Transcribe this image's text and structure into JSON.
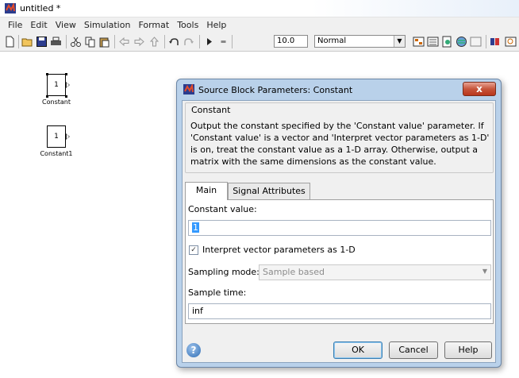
{
  "window": {
    "title": "untitled *"
  },
  "menu": [
    "File",
    "Edit",
    "View",
    "Simulation",
    "Format",
    "Tools",
    "Help"
  ],
  "toolbar": {
    "stop_time": "10.0",
    "sim_mode": "Normal",
    "icons": [
      "new-icon",
      "open-icon",
      "save-icon",
      "print-icon",
      "cut-icon",
      "copy-icon",
      "paste-icon",
      "back-icon",
      "forward-icon",
      "up-icon",
      "undo-icon",
      "redo-icon",
      "play-icon",
      "stop-icon",
      "build-icon",
      "model-explorer-icon",
      "debug-icon",
      "library-icon",
      "viewer-icon",
      "model-advisor-icon",
      "zoom-icon"
    ]
  },
  "canvas": {
    "blocks": [
      {
        "value": "1",
        "label": "Constant"
      },
      {
        "value": "1",
        "label": "Constant1"
      }
    ]
  },
  "dialog": {
    "title": "Source Block Parameters: Constant",
    "close_label": "x",
    "group_title": "Constant",
    "description": "Output the constant specified by the 'Constant value' parameter. If 'Constant value' is a vector and 'Interpret vector parameters as 1-D' is on, treat the constant value as a 1-D array. Otherwise, output a matrix with the same dimensions as the constant value.",
    "tabs": [
      "Main",
      "Signal Attributes"
    ],
    "constant_value_label": "Constant value:",
    "constant_value": "1",
    "interpret_checked": true,
    "interpret_label": "Interpret vector parameters as 1-D",
    "sampling_mode_label": "Sampling mode:",
    "sampling_mode_value": "Sample based",
    "sample_time_label": "Sample time:",
    "sample_time_value": "inf",
    "buttons": {
      "ok": "OK",
      "cancel": "Cancel",
      "help": "Help"
    },
    "help_glyph": "?"
  }
}
